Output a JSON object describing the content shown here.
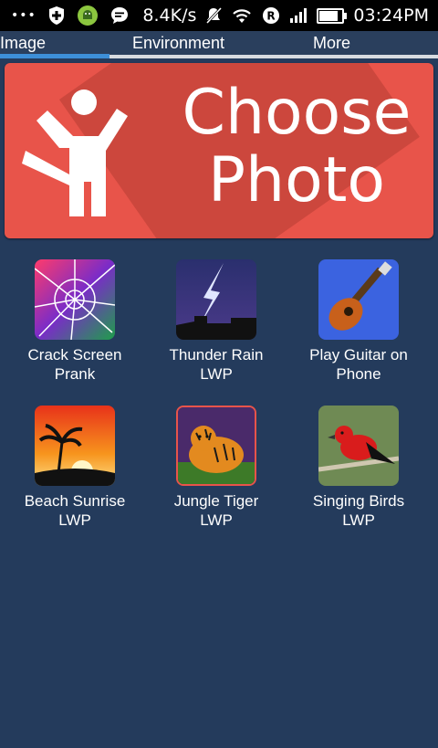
{
  "status_bar": {
    "dots": "•••",
    "speed": "8.4K/s",
    "time": "03:24PM",
    "battery_level": 0.9,
    "r_badge": "R"
  },
  "tabs": [
    {
      "label": "Image",
      "active": true
    },
    {
      "label": "Environment",
      "active": false
    },
    {
      "label": "More",
      "active": false
    }
  ],
  "banner": {
    "line1": "Choose",
    "line2": "Photo",
    "color": "#e8544a"
  },
  "apps": [
    {
      "line1": "Crack Screen",
      "line2": "Prank",
      "icon": "crack-screen-thumbnail"
    },
    {
      "line1": "Thunder Rain",
      "line2": "LWP",
      "icon": "thunder-rain-thumbnail"
    },
    {
      "line1": "Play Guitar on",
      "line2": "Phone",
      "icon": "guitar-thumbnail"
    },
    {
      "line1": "Beach Sunrise",
      "line2": "LWP",
      "icon": "beach-sunrise-thumbnail"
    },
    {
      "line1": "Jungle Tiger",
      "line2": "LWP",
      "icon": "tiger-thumbnail"
    },
    {
      "line1": "Singing Birds",
      "line2": "LWP",
      "icon": "bird-thumbnail"
    }
  ],
  "colors": {
    "background": "#243b5c",
    "tab_indicator": "#3d8fd8"
  }
}
